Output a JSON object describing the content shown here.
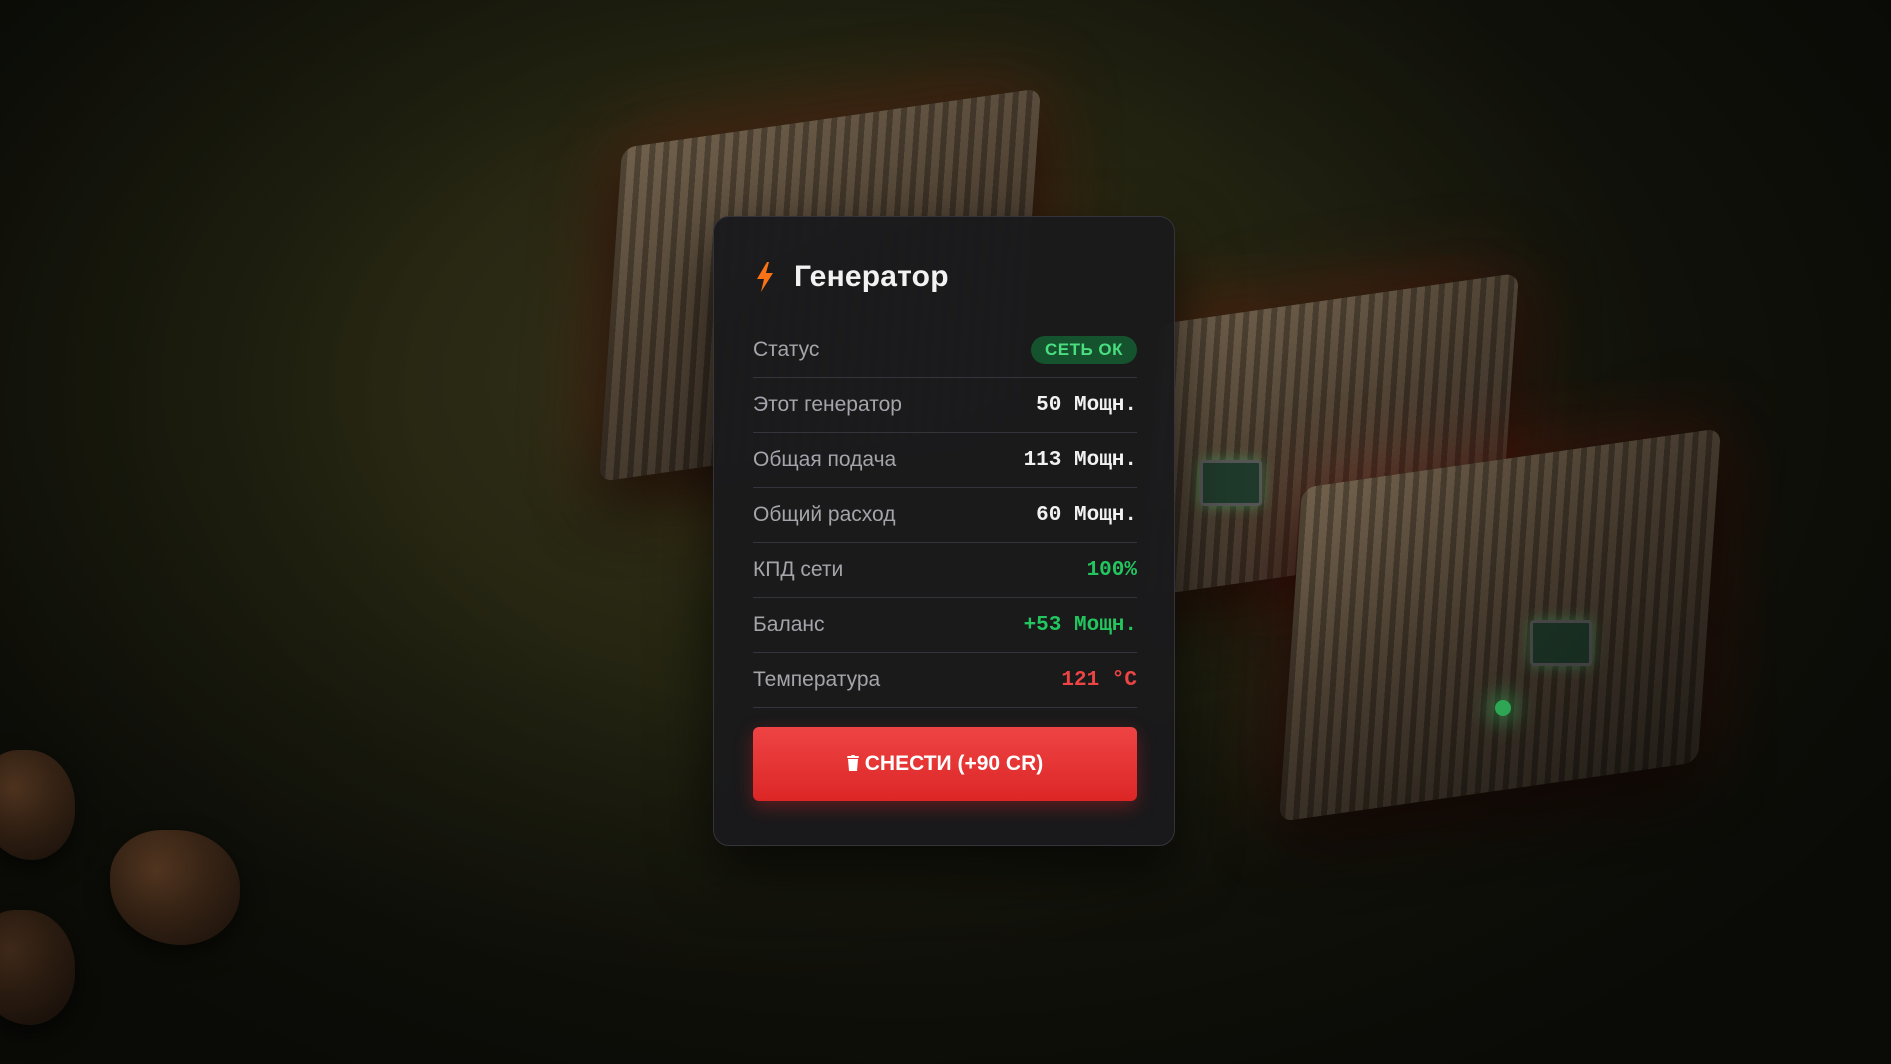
{
  "panel": {
    "title": "Генератор",
    "icon": "lightning-bolt-icon",
    "accent_color": "#f97316"
  },
  "rows": [
    {
      "label": "Статус",
      "value": "СЕТЬ ОК",
      "style": "badge"
    },
    {
      "label": "Этот генератор",
      "value": "50 Мощн.",
      "style": "default"
    },
    {
      "label": "Общая подача",
      "value": "113 Мощн.",
      "style": "default"
    },
    {
      "label": "Общий расход",
      "value": "60 Мощн.",
      "style": "default"
    },
    {
      "label": "КПД сети",
      "value": "100%",
      "style": "green"
    },
    {
      "label": "Баланс",
      "value": "+53 Мощн.",
      "style": "green"
    },
    {
      "label": "Температура",
      "value": "121 °C",
      "style": "red"
    }
  ],
  "demolish_button": {
    "icon": "trash-icon",
    "label": "СНЕСТИ (+90 CR)",
    "color": "#ef4444"
  },
  "colors": {
    "status_ok": "#4ade80",
    "positive": "#22c55e",
    "warning": "#ef4444"
  }
}
